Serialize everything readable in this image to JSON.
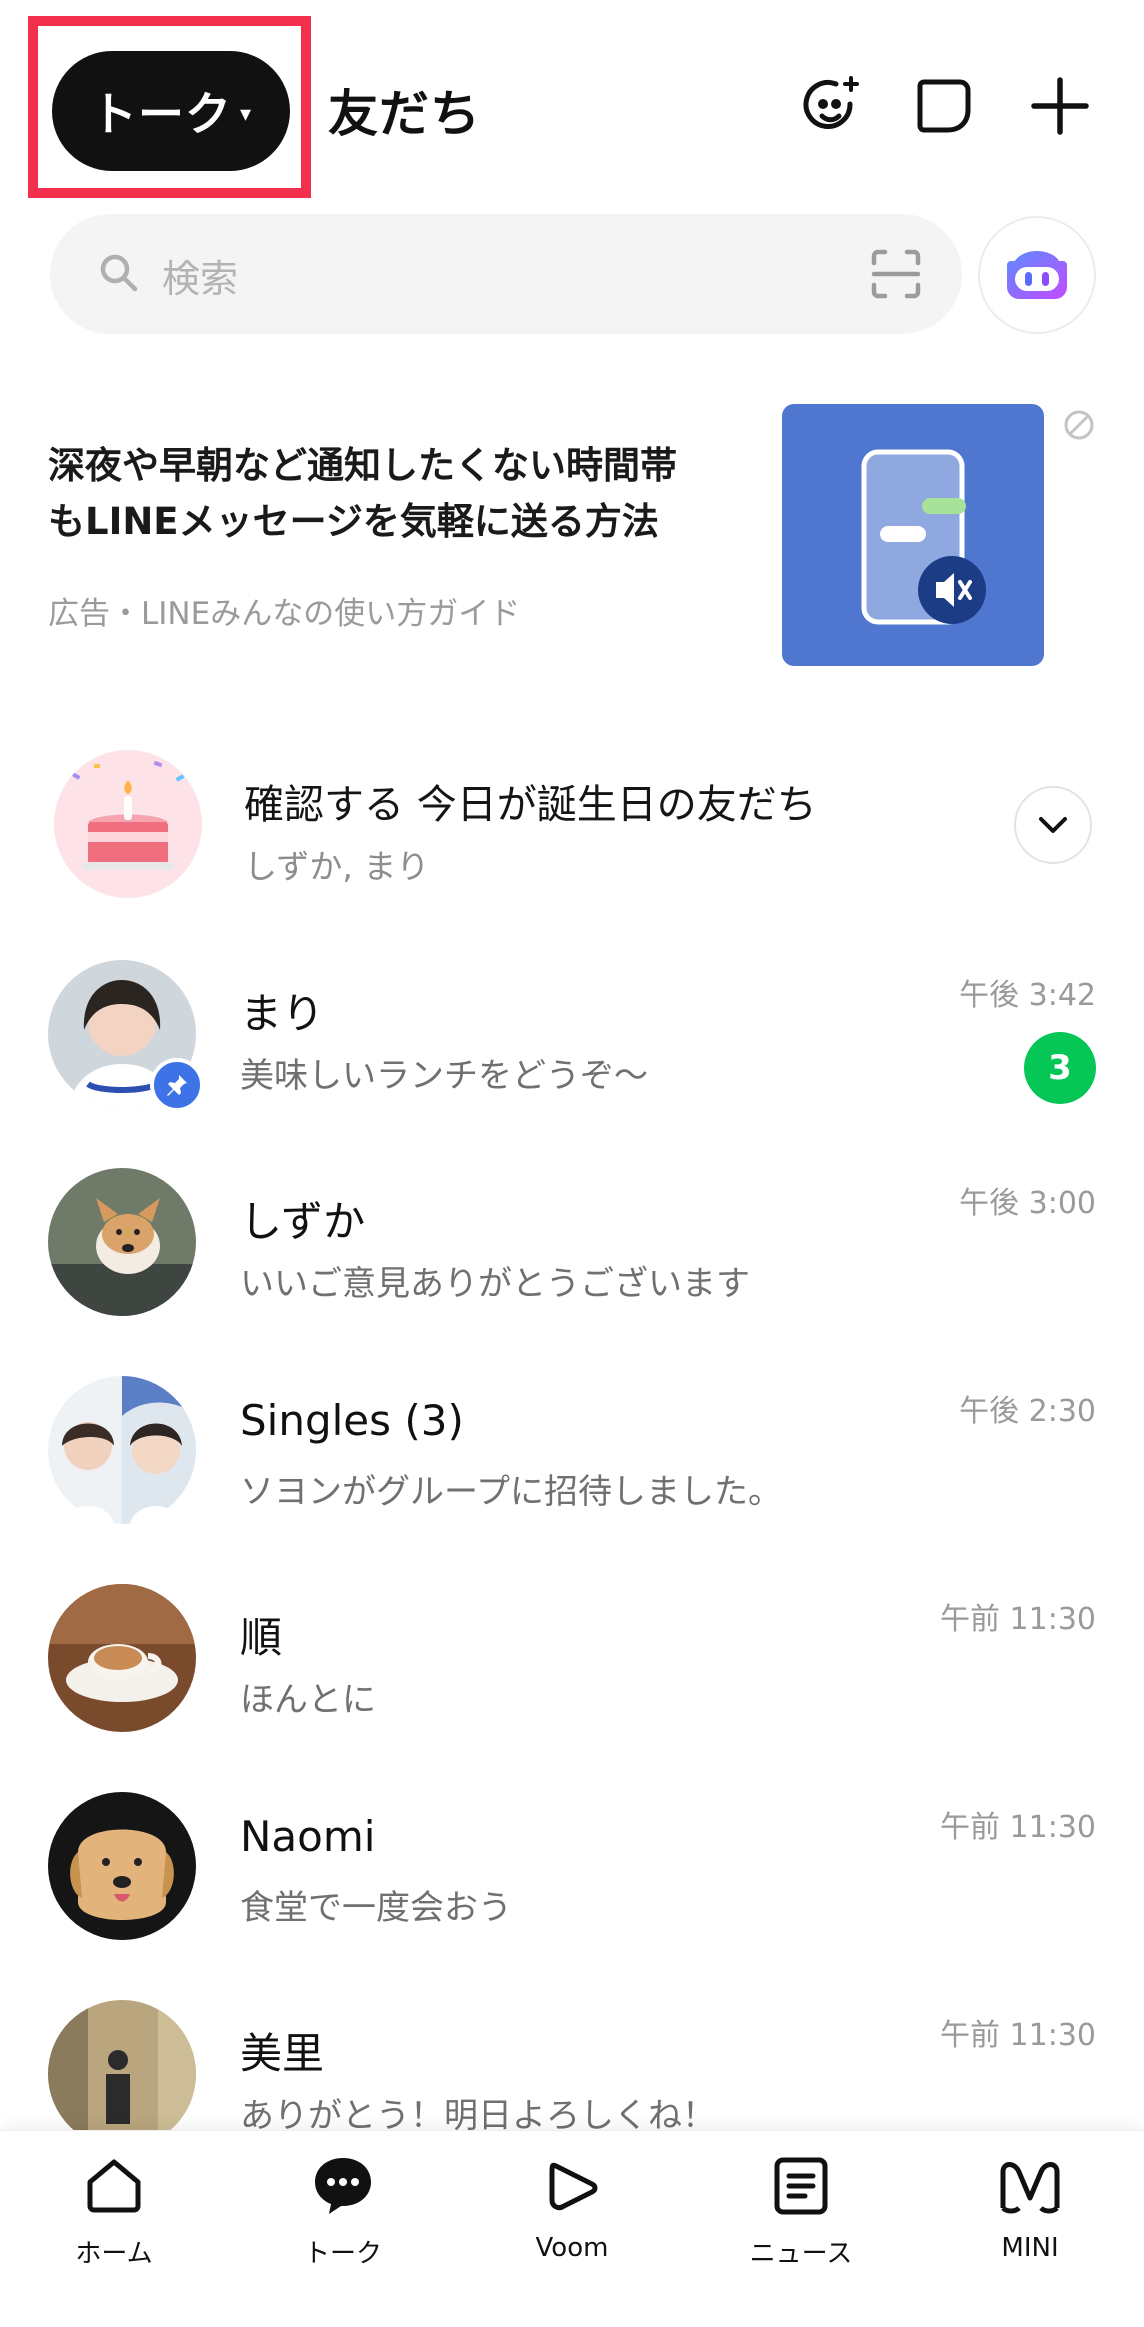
{
  "header": {
    "active_tab": "トーク",
    "active_tab_caret": "▾",
    "other_tab": "友だち",
    "icons": [
      "face-sparkle-icon",
      "new-chat-icon",
      "add-icon"
    ]
  },
  "search": {
    "placeholder": "検索",
    "icons": [
      "search-icon",
      "qr-scan-icon"
    ],
    "ai_button_icon": "ai-bot-icon"
  },
  "ad": {
    "title_line1": "深夜や早朝など通知したくない時間帯",
    "title_line2": "もLINEメッセージを気軽に送る方法",
    "source": "広告・LINEみんなの使い方ガイド",
    "hide_icon": "hide-ad-icon"
  },
  "birthday": {
    "title": "確認する 今日が誕生日の友だち",
    "names": "しずか, まり"
  },
  "chats": [
    {
      "name": "まり",
      "message": "美味しいランチをどうぞ〜",
      "time": "午後 3:42",
      "unread": "3",
      "pinned": true
    },
    {
      "name": "しずか",
      "message": "いいご意見ありがとうございます",
      "time": "午後 3:00"
    },
    {
      "name": "Singles (3)",
      "message": "ソヨンがグループに招待しました。",
      "time": "午後 2:30"
    },
    {
      "name": "順",
      "message": "ほんとに",
      "time": "午前 11:30"
    },
    {
      "name": "Naomi",
      "message": "食堂で一度会おう",
      "time": "午前 11:30"
    },
    {
      "name": "美里",
      "message": "ありがとう！明日よろしくね！",
      "time": "午前 11:30"
    }
  ],
  "nav": [
    {
      "label": "ホーム",
      "icon": "home-icon"
    },
    {
      "label": "トーク",
      "icon": "chat-bubble-icon",
      "active": true
    },
    {
      "label": "Voom",
      "icon": "voom-play-icon"
    },
    {
      "label": "ニュース",
      "icon": "news-icon"
    },
    {
      "label": "MINI",
      "icon": "mini-icon"
    }
  ],
  "colors": {
    "line_green": "#06c755",
    "highlight_red": "#f2304d",
    "ad_blue": "#4f77cf",
    "pin_blue": "#3d73e6"
  }
}
